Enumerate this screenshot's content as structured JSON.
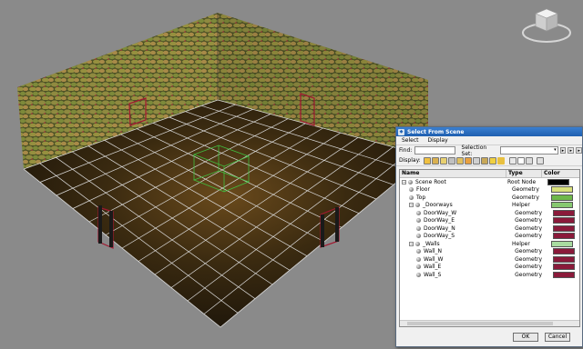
{
  "viewcube_icon": "viewcube-icon",
  "dialog": {
    "title": "Select From Scene",
    "menu": [
      "Select",
      "Display"
    ],
    "find_label": "Find:",
    "find_value": "",
    "selection_set_label": "Selection Set:",
    "selection_set_value": "",
    "display_label": "Display:",
    "columns": [
      "Name",
      "Type",
      "Color"
    ],
    "rows": [
      {
        "name": "Scene Root",
        "type": "Root Node",
        "color": "#000000",
        "indent": 0,
        "icon": "scene-root-icon"
      },
      {
        "name": "Floor",
        "type": "Geometry",
        "color": "#d8e07a",
        "indent": 1,
        "icon": "geometry-icon"
      },
      {
        "name": "Top",
        "type": "Geometry",
        "color": "#6fb84a",
        "indent": 1,
        "icon": "geometry-icon"
      },
      {
        "name": "_Doorways",
        "type": "Helper",
        "color": "#86c870",
        "indent": 1,
        "icon": "helper-icon"
      },
      {
        "name": "DoorWay_W",
        "type": "Geometry",
        "color": "#8a1a3a",
        "indent": 2,
        "icon": "geometry-icon"
      },
      {
        "name": "DoorWay_E",
        "type": "Geometry",
        "color": "#8a1a3a",
        "indent": 2,
        "icon": "geometry-icon"
      },
      {
        "name": "DoorWay_N",
        "type": "Geometry",
        "color": "#8a1a3a",
        "indent": 2,
        "icon": "geometry-icon"
      },
      {
        "name": "DoorWay_S",
        "type": "Geometry",
        "color": "#8a1a3a",
        "indent": 2,
        "icon": "geometry-icon"
      },
      {
        "name": "_Walls",
        "type": "Helper",
        "color": "#a8dca0",
        "indent": 1,
        "icon": "helper-icon"
      },
      {
        "name": "Wall_N",
        "type": "Geometry",
        "color": "#8a1a3a",
        "indent": 2,
        "icon": "geometry-icon"
      },
      {
        "name": "Wall_W",
        "type": "Geometry",
        "color": "#8a1a3a",
        "indent": 2,
        "icon": "geometry-icon"
      },
      {
        "name": "Wall_E",
        "type": "Geometry",
        "color": "#8a1a3a",
        "indent": 2,
        "icon": "geometry-icon"
      },
      {
        "name": "Wall_S",
        "type": "Geometry",
        "color": "#8a1a3a",
        "indent": 2,
        "icon": "geometry-icon"
      }
    ],
    "ok_label": "OK",
    "cancel_label": "Cancel"
  },
  "colors": {
    "viewport_bg": "#8a8a8a",
    "grid": "#e0e0e0",
    "floor": "#3a2a14",
    "wall": "#5a5a30",
    "doorway_frame": "#a01830",
    "selection_box": "#40c040"
  }
}
